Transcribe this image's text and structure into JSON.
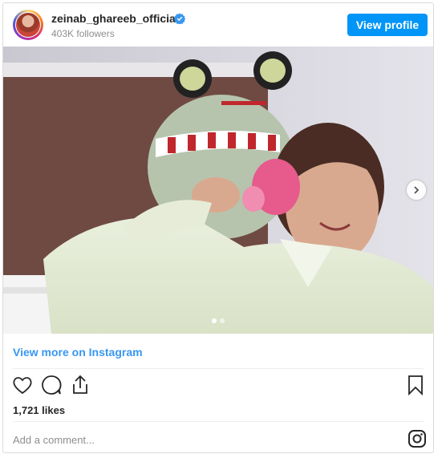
{
  "header": {
    "username": "zeinab_ghareeb_official",
    "followers": "403K followers",
    "view_profile_label": "View profile",
    "verified_icon": "verified-badge-icon"
  },
  "post": {
    "image_slides_total": 2,
    "active_slide": 1,
    "view_more_label": "View more on Instagram"
  },
  "actions": {
    "icons": [
      "heart-icon",
      "comment-icon",
      "share-icon",
      "bookmark-icon"
    ]
  },
  "likes_text": "1,721 likes",
  "comment": {
    "placeholder": "Add a comment..."
  },
  "colors": {
    "brand_blue": "#0095f6",
    "link_blue": "#3897f0",
    "muted_text": "#8e8e8e",
    "border": "#dbdbdb"
  }
}
